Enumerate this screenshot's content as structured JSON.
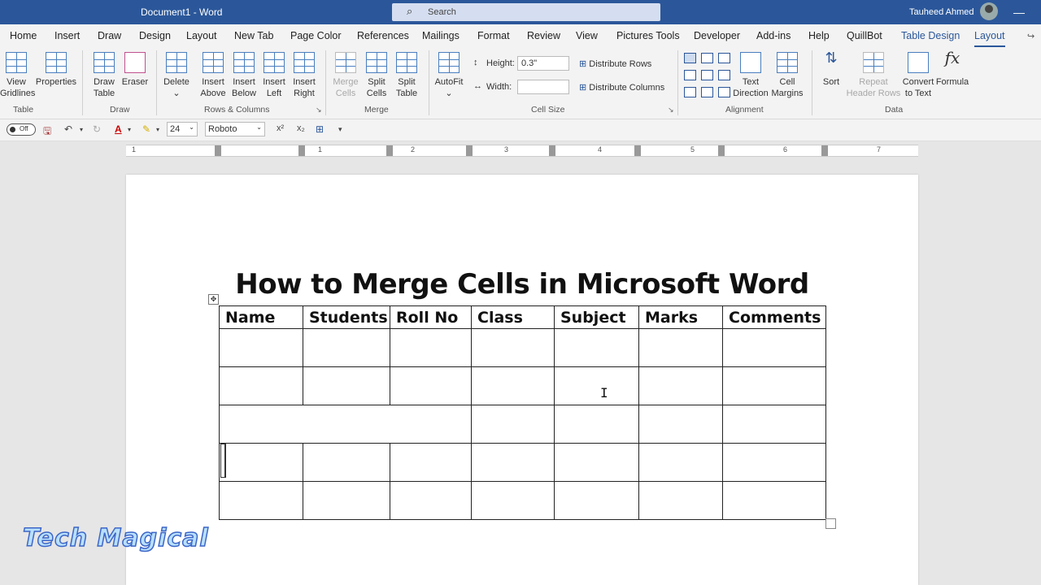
{
  "titlebar": {
    "document": "Document1  -  Word",
    "search_placeholder": "Search",
    "user": "Tauheed Ahmed"
  },
  "menu": {
    "tabs": [
      "Home",
      "Insert",
      "Draw",
      "Design",
      "Layout",
      "New Tab",
      "Page Color",
      "References",
      "Mailings",
      "Format",
      "Review",
      "View",
      "Pictures Tools",
      "Developer",
      "Add-ins",
      "Help",
      "QuillBot"
    ],
    "context_tabs": [
      "Table Design",
      "Layout"
    ],
    "active": "Layout"
  },
  "ribbon": {
    "table": {
      "view_gridlines": "View Gridlines",
      "view_gridlines_l1": "View",
      "view_gridlines_l2": "Gridlines",
      "properties": "Properties",
      "group": "Table"
    },
    "draw": {
      "draw_table_l1": "Draw",
      "draw_table_l2": "Table",
      "eraser": "Eraser",
      "group": "Draw"
    },
    "rows_columns": {
      "delete": "Delete",
      "insert_above_l1": "Insert",
      "insert_above_l2": "Above",
      "insert_below_l1": "Insert",
      "insert_below_l2": "Below",
      "insert_left_l1": "Insert",
      "insert_left_l2": "Left",
      "insert_right_l1": "Insert",
      "insert_right_l2": "Right",
      "group": "Rows & Columns"
    },
    "merge": {
      "merge_cells_l1": "Merge",
      "merge_cells_l2": "Cells",
      "split_cells_l1": "Split",
      "split_cells_l2": "Cells",
      "split_table_l1": "Split",
      "split_table_l2": "Table",
      "group": "Merge"
    },
    "cell_size": {
      "autofit": "AutoFit",
      "height_label": "Height:",
      "height_value": "0.3\"",
      "width_label": "Width:",
      "width_value": "",
      "distribute_rows": "Distribute Rows",
      "distribute_columns": "Distribute Columns",
      "group": "Cell Size"
    },
    "alignment": {
      "text_direction_l1": "Text",
      "text_direction_l2": "Direction",
      "cell_margins_l1": "Cell",
      "cell_margins_l2": "Margins",
      "group": "Alignment"
    },
    "data": {
      "sort": "Sort",
      "repeat_header_l1": "Repeat",
      "repeat_header_l2": "Header Rows",
      "convert_l1": "Convert",
      "convert_l2": "to Text",
      "formula": "Formula",
      "group": "Data"
    }
  },
  "qat": {
    "autosave": "Off",
    "font_size": "24",
    "font_name": "Roboto"
  },
  "ruler": {
    "numbers": [
      "1",
      "1",
      "2",
      "3",
      "4",
      "5",
      "6",
      "7"
    ]
  },
  "document": {
    "title": "How to Merge Cells in Microsoft Word",
    "table": {
      "headers": [
        "Name",
        "Students",
        "Roll No",
        "Class",
        "Subject",
        "Marks",
        "Comments"
      ],
      "row_count": 5
    }
  },
  "watermark": "Tech Magical"
}
